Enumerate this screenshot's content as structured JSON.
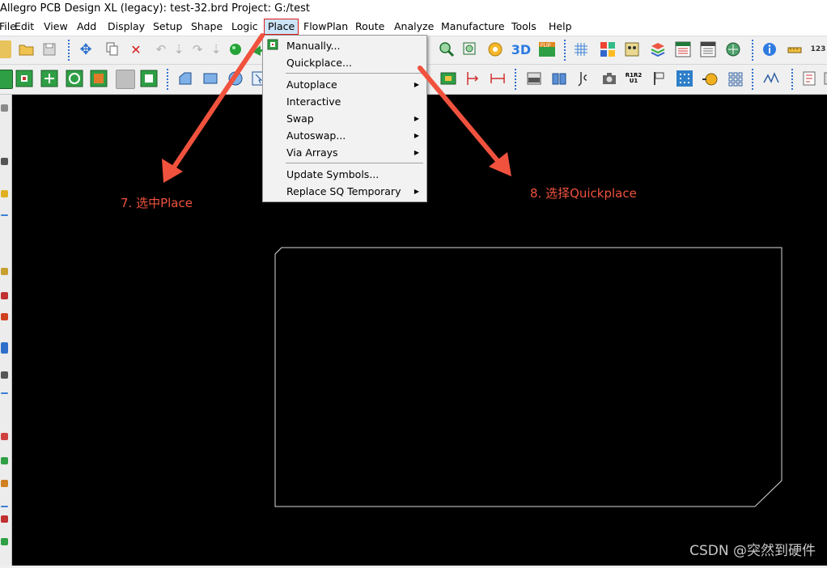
{
  "window": {
    "title": "Allegro PCB Design XL (legacy): test-32.brd  Project: G:/test"
  },
  "menubar": {
    "items": [
      {
        "label": "File"
      },
      {
        "label": "Edit"
      },
      {
        "label": "View"
      },
      {
        "label": "Add"
      },
      {
        "label": "Display"
      },
      {
        "label": "Setup"
      },
      {
        "label": "Shape"
      },
      {
        "label": "Logic"
      },
      {
        "label": "Place"
      },
      {
        "label": "FlowPlan"
      },
      {
        "label": "Route"
      },
      {
        "label": "Analyze"
      },
      {
        "label": "Manufacture"
      },
      {
        "label": "Tools"
      },
      {
        "label": "Help"
      }
    ],
    "active": "Place"
  },
  "place_menu": {
    "items": [
      {
        "label": "Manually...",
        "submenu": false
      },
      {
        "label": "Quickplace...",
        "submenu": false
      },
      {
        "label": "Autoplace",
        "submenu": true
      },
      {
        "label": "Interactive",
        "submenu": false
      },
      {
        "label": "Swap",
        "submenu": true
      },
      {
        "label": "Autoswap...",
        "submenu": true
      },
      {
        "label": "Via Arrays",
        "submenu": true
      },
      {
        "label": "Update Symbols...",
        "submenu": false
      },
      {
        "label": "Replace SQ Temporary",
        "submenu": true
      }
    ]
  },
  "annotations": {
    "step7": "7. 选中Place",
    "step8": "8. 选择Quickplace",
    "arrow_color": "#f0523e"
  },
  "watermark": "CSDN @突然到硬件",
  "colors": {
    "canvas_bg": "#000000",
    "board_outline": "#d8d8d8",
    "menu_highlight_border": "#e01818"
  }
}
